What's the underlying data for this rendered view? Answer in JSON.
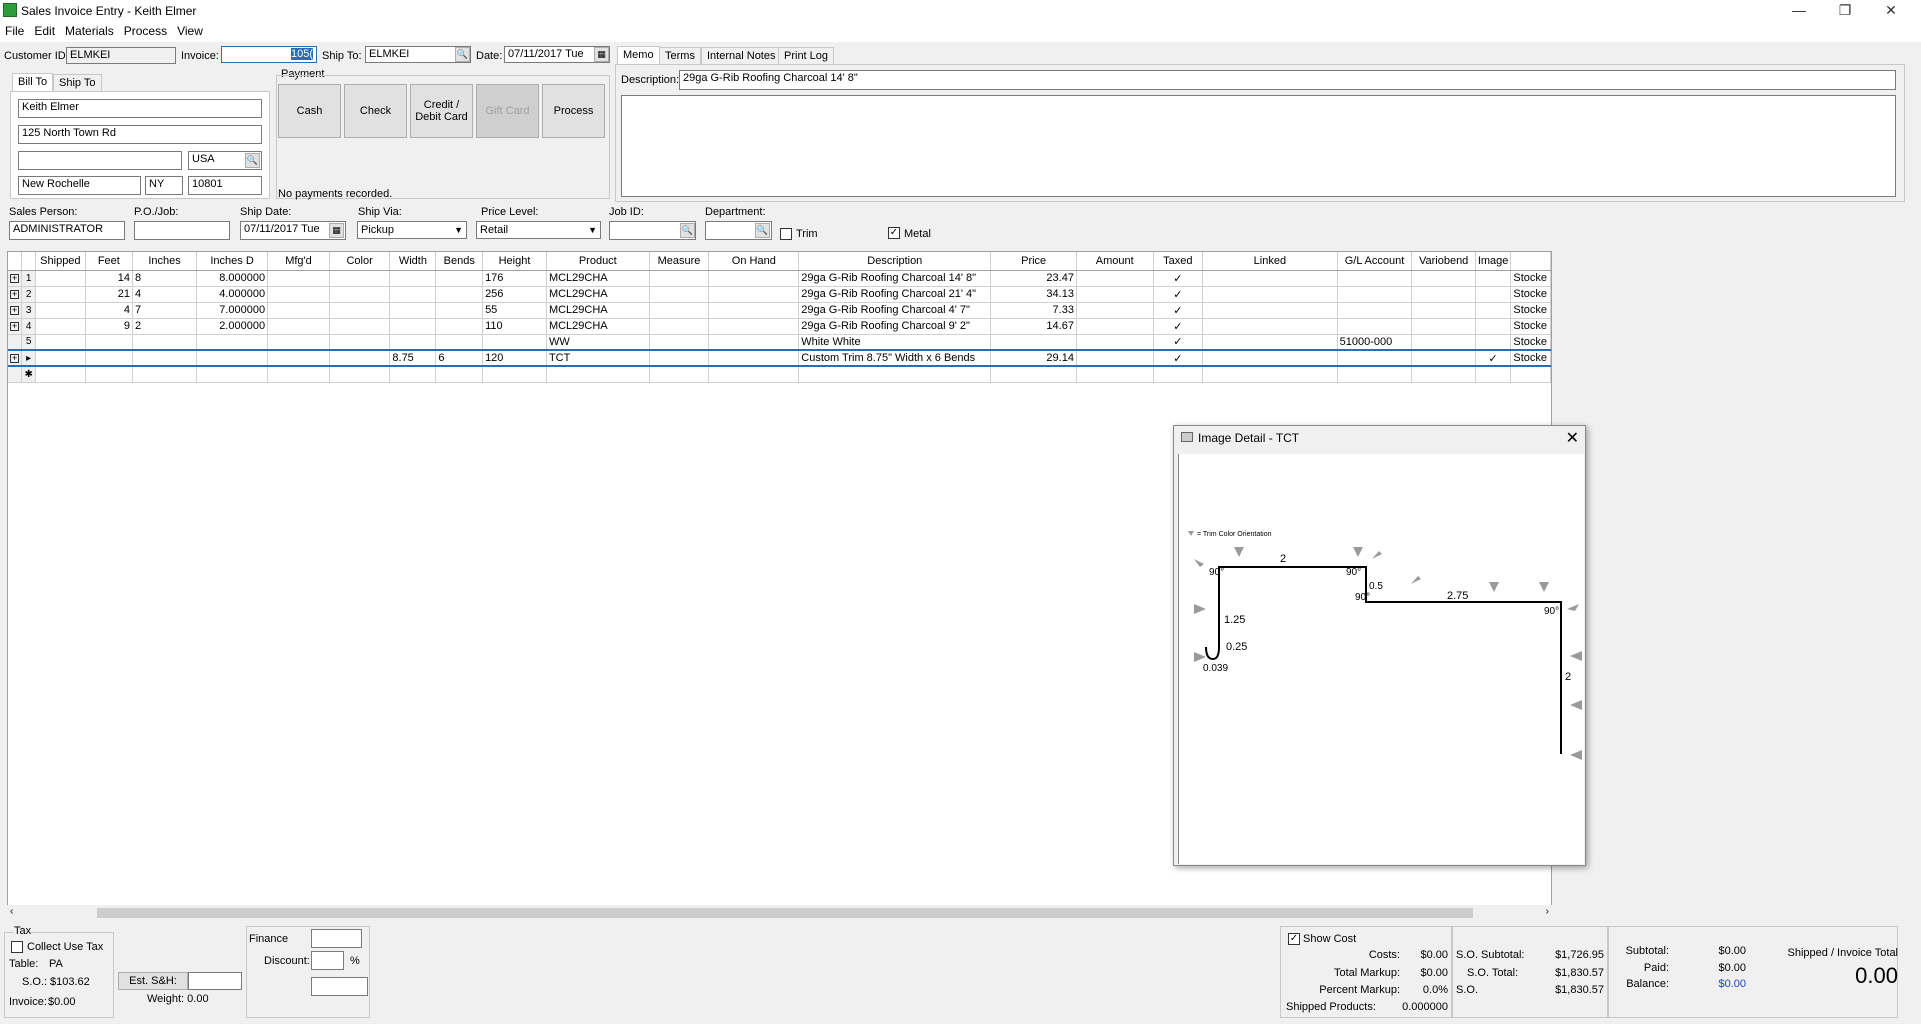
{
  "window": {
    "title": "Sales Invoice Entry - Keith Elmer"
  },
  "menu": [
    "File",
    "Edit",
    "Materials",
    "Process",
    "View"
  ],
  "header": {
    "customer_id_label": "Customer ID:",
    "customer_id": "ELMKEI",
    "invoice_label": "Invoice:",
    "invoice": "105(",
    "ship_to_label": "Ship To:",
    "ship_to": "ELMKEI",
    "date_label": "Date:",
    "date": "07/11/2017 Tue"
  },
  "address": {
    "tab_bill": "Bill To",
    "tab_ship": "Ship To",
    "name": "Keith Elmer",
    "street": "125 North Town Rd",
    "line2": "",
    "country": "USA",
    "city": "New Rochelle",
    "state": "NY",
    "zip": "10801"
  },
  "payment": {
    "label": "Payment",
    "cash": "Cash",
    "check": "Check",
    "credit": "Credit / Debit Card",
    "gift": "Gift Card",
    "process": "Process",
    "status": "No payments recorded."
  },
  "memo": {
    "tabs": [
      "Memo",
      "Terms",
      "Internal Notes",
      "Print Log"
    ],
    "description_label": "Description:",
    "description": "29ga G-Rib Roofing Charcoal 14' 8\""
  },
  "info": {
    "sales_person_label": "Sales Person:",
    "sales_person": "ADMINISTRATOR",
    "po_label": "P.O./Job:",
    "po": "",
    "ship_date_label": "Ship Date:",
    "ship_date": "07/11/2017 Tue",
    "ship_via_label": "Ship Via:",
    "ship_via": "Pickup",
    "price_level_label": "Price Level:",
    "price_level": "Retail",
    "job_id_label": "Job ID:",
    "job_id": "",
    "department_label": "Department:",
    "department": "",
    "trim_label": "Trim",
    "metal_label": "Metal",
    "metal_checked": "✓"
  },
  "grid": {
    "columns": [
      "Shipped",
      "Feet",
      "Inches",
      "Inches D",
      "Mfg'd",
      "Color",
      "Width",
      "Bends",
      "Height",
      "Product",
      "Measure",
      "On Hand",
      "Description",
      "Price",
      "Amount",
      "Taxed",
      "Linked",
      "G/L Account",
      "Variobend",
      "Image",
      ""
    ],
    "rows": [
      {
        "ind": "1",
        "shipped": "",
        "feet": "14",
        "inches": "8",
        "inchesd": "8.000000",
        "mfgd": "",
        "color": "",
        "width": "",
        "bends": "",
        "height": "176",
        "product": "MCL29CHA",
        "measure": "",
        "onhand": "",
        "desc": "29ga G-Rib Roofing Charcoal 14' 8\"",
        "price": "23.47",
        "amount": "",
        "taxed": "✓",
        "linked": "",
        "gl": "",
        "vario": "",
        "image": "",
        "stock": "Stocke"
      },
      {
        "ind": "2",
        "shipped": "",
        "feet": "21",
        "inches": "4",
        "inchesd": "4.000000",
        "mfgd": "",
        "color": "",
        "width": "",
        "bends": "",
        "height": "256",
        "product": "MCL29CHA",
        "measure": "",
        "onhand": "",
        "desc": "29ga G-Rib Roofing Charcoal 21' 4\"",
        "price": "34.13",
        "amount": "",
        "taxed": "✓",
        "linked": "",
        "gl": "",
        "vario": "",
        "image": "",
        "stock": "Stocke"
      },
      {
        "ind": "3",
        "shipped": "",
        "feet": "4",
        "inches": "7",
        "inchesd": "7.000000",
        "mfgd": "",
        "color": "",
        "width": "",
        "bends": "",
        "height": "55",
        "product": "MCL29CHA",
        "measure": "",
        "onhand": "",
        "desc": "29ga G-Rib Roofing Charcoal 4' 7\"",
        "price": "7.33",
        "amount": "",
        "taxed": "✓",
        "linked": "",
        "gl": "",
        "vario": "",
        "image": "",
        "stock": "Stocke"
      },
      {
        "ind": "4",
        "shipped": "",
        "feet": "9",
        "inches": "2",
        "inchesd": "2.000000",
        "mfgd": "",
        "color": "",
        "width": "",
        "bends": "",
        "height": "110",
        "product": "MCL29CHA",
        "measure": "",
        "onhand": "",
        "desc": "29ga G-Rib Roofing Charcoal 9' 2\"",
        "price": "14.67",
        "amount": "",
        "taxed": "✓",
        "linked": "",
        "gl": "",
        "vario": "",
        "image": "",
        "stock": "Stocke"
      },
      {
        "ind": "5",
        "shipped": "",
        "feet": "",
        "inches": "",
        "inchesd": "",
        "mfgd": "",
        "color": "",
        "width": "",
        "bends": "",
        "height": "",
        "product": "WW",
        "measure": "",
        "onhand": "",
        "desc": "White White",
        "price": "",
        "amount": "",
        "taxed": "✓",
        "linked": "",
        "gl": "51000-000",
        "vario": "",
        "image": "",
        "stock": "Stocke"
      },
      {
        "ind": "▸",
        "shipped": "",
        "feet": "",
        "inches": "",
        "inchesd": "",
        "mfgd": "",
        "color": "",
        "width": "8.75",
        "bends": "6",
        "height": "120",
        "product": "TCT",
        "measure": "",
        "onhand": "",
        "desc": "Custom Trim 8.75\" Width x 6 Bends",
        "price": "29.14",
        "amount": "",
        "taxed": "✓",
        "linked": "",
        "gl": "",
        "vario": "",
        "image": "✓",
        "stock": "Stocke"
      }
    ],
    "new_row_ind": "✱"
  },
  "image_detail": {
    "title": "Image Detail - TCT",
    "legend": "= Trim Color Orientation",
    "dims": [
      "2",
      "90°",
      "90°",
      "0.5",
      "90°",
      "2.75",
      "90°",
      "1.25",
      "0.25",
      "0.039",
      "2"
    ]
  },
  "tax": {
    "label": "Tax",
    "collect_use_tax": "Collect Use Tax",
    "table_label": "Table:",
    "table": "PA",
    "so_label": "S.O.:",
    "so": "$103.62",
    "invoice_label": "Invoice:",
    "invoice": "$0.00",
    "est_sh": "Est. S&H:",
    "weight": "Weight: 0.00"
  },
  "finance": {
    "finance_label": "Finance",
    "discount_label": "Discount:",
    "percent": "%"
  },
  "cost": {
    "show_cost": "Show Cost",
    "costs_label": "Costs:",
    "costs": "$0.00",
    "markup_label": "Total Markup:",
    "markup": "$0.00",
    "percent_label": "Percent Markup:",
    "percent": "0.0%",
    "shipped_label": "Shipped Products:",
    "shipped": "0.000000"
  },
  "so_totals": {
    "subtotal_label": "S.O. Subtotal:",
    "subtotal": "$1,726.95",
    "total_label": "S.O. Total:",
    "total": "$1,830.57",
    "so_label": "S.O.",
    "so": "$1,830.57"
  },
  "inv_totals": {
    "subtotal_label": "Subtotal:",
    "subtotal": "$0.00",
    "paid_label": "Paid:",
    "paid": "$0.00",
    "balance_label": "Balance:",
    "balance": "$0.00",
    "shipped_total_label": "Shipped / Invoice Total",
    "shipped_total": "0.00"
  }
}
